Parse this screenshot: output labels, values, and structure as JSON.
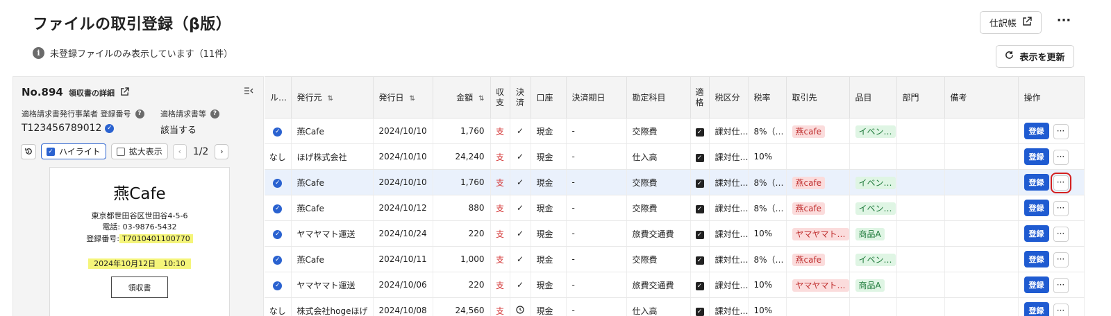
{
  "header": {
    "title": "ファイルの取引登録（β版）",
    "journal_label": "仕訳帳",
    "more_label": "···",
    "refresh_label": "表示を更新",
    "info_text": "未登録ファイルのみ表示しています（11件）"
  },
  "detail": {
    "doc_no": "No.894",
    "detail_link": "領収書の詳細",
    "reg_no_label": "適格請求書発行事業者 登録番号",
    "reg_no_value": "T123456789012",
    "qualified_label": "適格請求書等",
    "qualified_value": "該当する",
    "highlight_label": "ハイライト",
    "zoom_label": "拡大表示",
    "pager": "1/2",
    "receipt": {
      "store": "燕Cafe",
      "address": "東京都世田谷区世田谷4-5-6",
      "phone": "電話: 03-9876-5432",
      "reg_prefix": "登録番号:",
      "reg_number": "T7010401100770",
      "datetime": "2024年10月12日　10:10",
      "button": "領収書"
    }
  },
  "table": {
    "headers": {
      "rule": "ル…",
      "issuer": "発行元",
      "date": "発行日",
      "amount": "金額",
      "type": "収支",
      "settled": "決済",
      "account": "口座",
      "due": "決済期日",
      "subject": "勘定科目",
      "qualified": "適格",
      "tax_cat": "税区分",
      "tax_rate": "税率",
      "partner": "取引先",
      "item": "品目",
      "dept": "部門",
      "memo": "備考",
      "ops": "操作"
    },
    "register_label": "登録",
    "rows": [
      {
        "rule": "check",
        "issuer": "燕Cafe",
        "date": "2024/10/10",
        "amount": "1,760",
        "type": "支",
        "settled": "✓",
        "account": "現金",
        "due": "-",
        "subject": "交際費",
        "tax_cat": "課対仕…",
        "tax_rate": "8%（…",
        "partner": "燕cafe",
        "item": "イベン…"
      },
      {
        "rule": "なし",
        "issuer": "ほげ株式会社",
        "date": "2024/10/10",
        "amount": "24,240",
        "type": "支",
        "settled": "✓",
        "account": "現金",
        "due": "-",
        "subject": "仕入高",
        "tax_cat": "課対仕…",
        "tax_rate": "10%",
        "partner": "",
        "item": ""
      },
      {
        "rule": "check",
        "issuer": "燕Cafe",
        "date": "2024/10/10",
        "amount": "1,760",
        "type": "支",
        "settled": "✓",
        "account": "現金",
        "due": "-",
        "subject": "交際費",
        "tax_cat": "課対仕…",
        "tax_rate": "8%（…",
        "partner": "燕cafe",
        "item": "イベン…",
        "selected": true
      },
      {
        "rule": "check",
        "issuer": "燕Cafe",
        "date": "2024/10/12",
        "amount": "880",
        "type": "支",
        "settled": "✓",
        "account": "現金",
        "due": "-",
        "subject": "交際費",
        "tax_cat": "課対仕…",
        "tax_rate": "8%（…",
        "partner": "燕cafe",
        "item": "イベン…"
      },
      {
        "rule": "check",
        "issuer": "ヤマヤマト運送",
        "date": "2024/10/24",
        "amount": "220",
        "type": "支",
        "settled": "✓",
        "account": "現金",
        "due": "-",
        "subject": "旅費交通費",
        "tax_cat": "課対仕…",
        "tax_rate": "10%",
        "partner": "ヤマヤマト…",
        "item": "商品A"
      },
      {
        "rule": "check",
        "issuer": "燕Cafe",
        "date": "2024/10/11",
        "amount": "1,000",
        "type": "支",
        "settled": "✓",
        "account": "現金",
        "due": "-",
        "subject": "交際費",
        "tax_cat": "課対仕…",
        "tax_rate": "8%（…",
        "partner": "燕cafe",
        "item": "イベン…"
      },
      {
        "rule": "check",
        "issuer": "ヤマヤマト運送",
        "date": "2024/10/06",
        "amount": "220",
        "type": "支",
        "settled": "✓",
        "account": "現金",
        "due": "-",
        "subject": "旅費交通費",
        "tax_cat": "課対仕…",
        "tax_rate": "10%",
        "partner": "ヤマヤマト…",
        "item": "商品A"
      },
      {
        "rule": "なし",
        "issuer": "株式会社hogeほげ",
        "date": "2024/10/08",
        "amount": "24,560",
        "type": "支",
        "settled": "clock",
        "account": "現金",
        "due": "-",
        "subject": "仕入高",
        "tax_cat": "課対仕…",
        "tax_rate": "10%",
        "partner": "",
        "item": ""
      }
    ]
  },
  "colors": {
    "accent": "#1f5bd1",
    "expense": "#d53a3a",
    "highlight": "#f5f57a",
    "focus_outline": "#d42020"
  }
}
